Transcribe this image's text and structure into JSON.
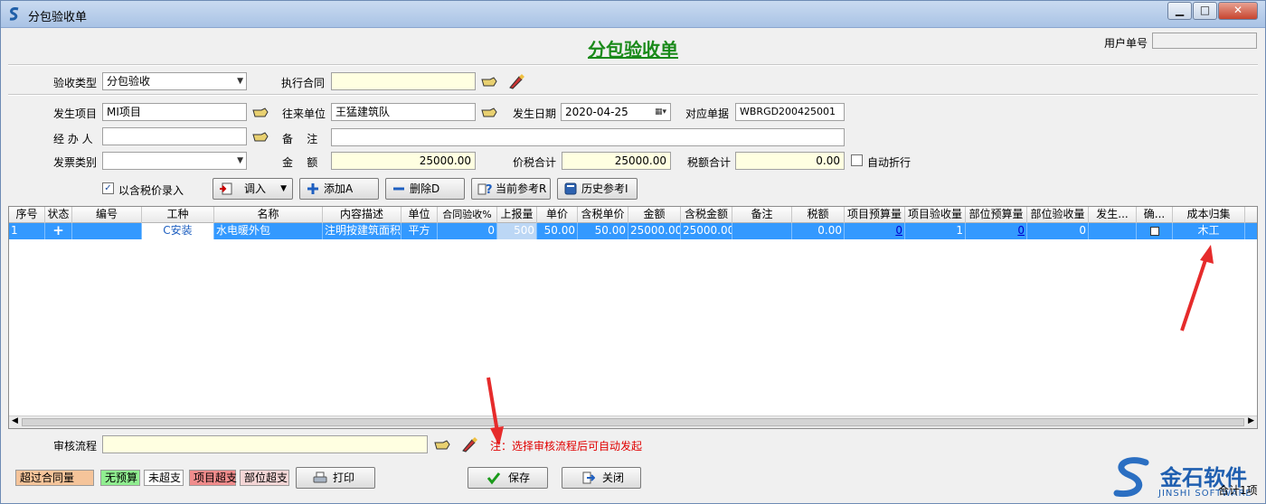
{
  "window": {
    "title": "分包验收单",
    "minimize": "▁",
    "maximize": "□",
    "close": "✕"
  },
  "header": {
    "page_title": "分包验收单",
    "user_doc_label": "用户单号",
    "user_doc_value": ""
  },
  "form": {
    "acceptance_type_label": "验收类型",
    "acceptance_type_value": "分包验收",
    "contract_label": "执行合同",
    "contract_value": "",
    "project_label": "发生项目",
    "project_value": "MI项目",
    "partner_label": "往来单位",
    "partner_value": "王猛建筑队",
    "date_label": "发生日期",
    "date_value": "2020-04-25",
    "doc_label": "对应单据",
    "doc_value": "WBRGD200425001",
    "handler_label": "经 办 人",
    "handler_value": "",
    "remark_label": "备    注",
    "remark_value": "",
    "invoice_label": "发票类别",
    "invoice_value": "",
    "amount_label": "金    额",
    "amount_value": "25000.00",
    "tax_total_label": "价税合计",
    "tax_total_value": "25000.00",
    "tax_sum_label": "税额合计",
    "tax_sum_value": "0.00",
    "auto_discount_label": "自动折行",
    "tax_incl_label": "以含税价录入"
  },
  "toolbar": {
    "import_label": "调入",
    "add_label": "添加A",
    "delete_label": "删除D",
    "current_ref_label": "当前参考R",
    "history_ref_label": "历史参考I"
  },
  "table": {
    "columns": [
      "序号",
      "状态",
      "编号",
      "工种",
      "名称",
      "内容描述",
      "单位",
      "合同验收%",
      "上报量",
      "单价",
      "含税单价",
      "金额",
      "含税金额",
      "备注",
      "税额",
      "项目预算量",
      "项目验收量",
      "部位预算量",
      "部位验收量",
      "发生...",
      "确...",
      "成本归集"
    ],
    "rows": [
      {
        "seq": "1",
        "status": "+",
        "code": "",
        "work_type": "C安装",
        "name": "水电暖外包",
        "desc": "注明按建筑面积",
        "unit": "平方",
        "contract_pct": "0",
        "reported": "500",
        "price": "50.00",
        "tax_price": "50.00",
        "amount": "25000.00",
        "tax_amount": "25000.00",
        "remark": "",
        "tax": "0.00",
        "proj_budget": "0",
        "proj_accept": "1",
        "part_budget": "0",
        "part_accept": "0",
        "occur": "",
        "confirm": "",
        "cost": "木工"
      }
    ]
  },
  "footer": {
    "flow_label": "审核流程",
    "flow_value": "",
    "flow_hint": "注：选择审核流程后可自动发起",
    "legend_over_contract": "超过合同量",
    "legend_no_budget": "无预算",
    "legend_not_over": "未超支",
    "legend_proj_over": "项目超支",
    "legend_part_over": "部位超支",
    "print_label": "打印",
    "save_label": "保存",
    "close_label": "关闭",
    "summary": "合计1项"
  },
  "brand": {
    "name": "金石软件",
    "sub": "JINSHI SOFTWARE"
  },
  "colors": {
    "title_green": "#1a8a1a",
    "row_selected": "#3399ff",
    "hint_red": "#e00000",
    "legend_over_contract": "#f5c49a",
    "legend_no_budget": "#90ee90",
    "legend_proj_over": "#f08c8c",
    "legend_part_over": "#f4d6d6"
  }
}
